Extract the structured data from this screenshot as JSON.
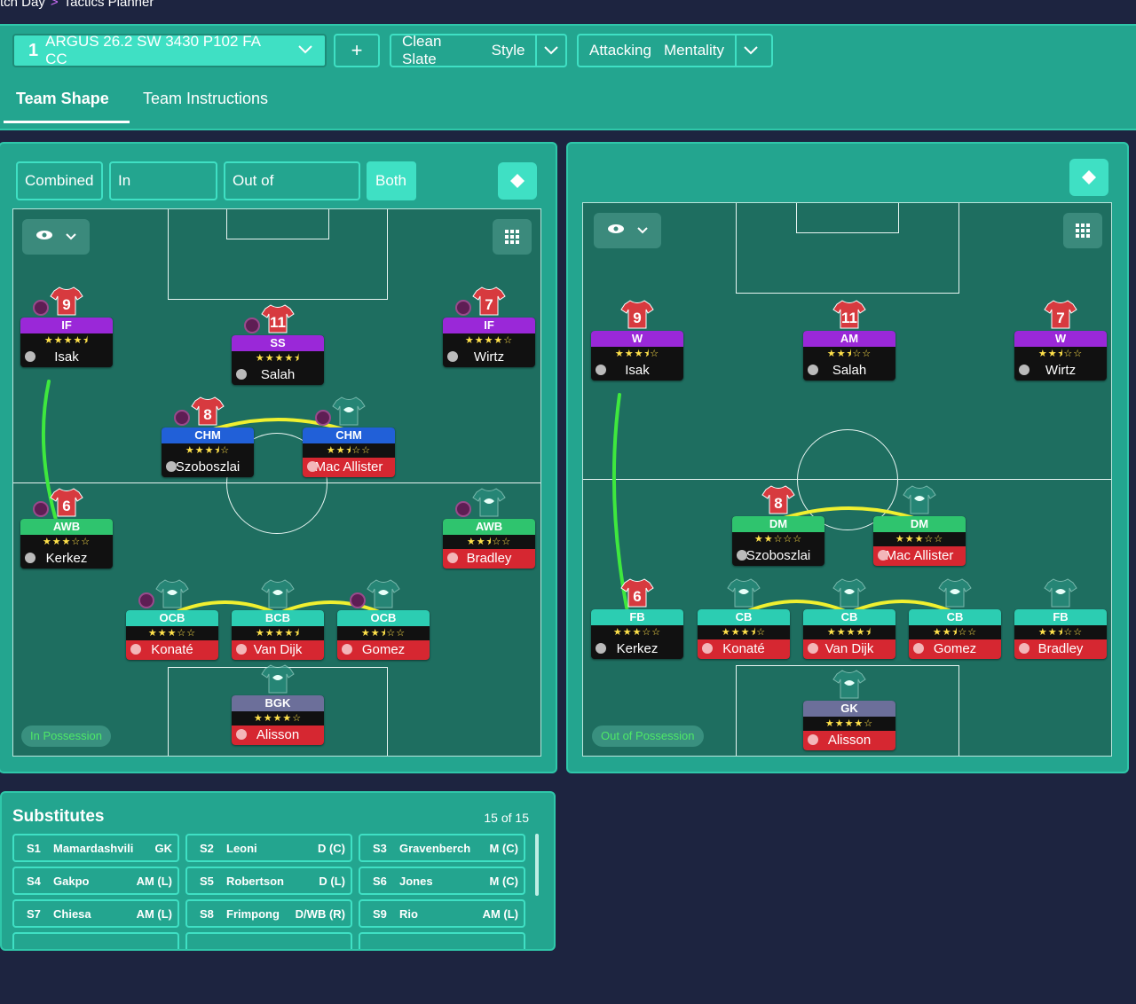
{
  "breadcrumb": {
    "parent": "tch Day",
    "current": "Tactics Planner"
  },
  "toolbar": {
    "tactic_number": "1",
    "tactic_name": "ARGUS 26.2 SW 3430 P102 FA CC",
    "add_label": "+",
    "style_value": "Clean Slate",
    "style_label": "Style",
    "mentality_value": "Attacking",
    "mentality_label": "Mentality"
  },
  "tabs": {
    "team_shape": "Team Shape",
    "team_instructions": "Team Instructions"
  },
  "view_buttons": {
    "combined": "Combined",
    "in_possession": "In Possession",
    "out_of_possession": "Out of Possession",
    "both": "Both"
  },
  "left_pitch": {
    "chip": "In Possession",
    "players": [
      {
        "id": "isak",
        "num": "9",
        "role": "IF",
        "stars": "★★★★⯨",
        "name": "Isak",
        "roleColor": "purple",
        "nameStyle": "dark"
      },
      {
        "id": "salah",
        "num": "11",
        "role": "SS",
        "stars": "★★★★⯨",
        "name": "Salah",
        "roleColor": "purple",
        "nameStyle": "dark"
      },
      {
        "id": "wirtz",
        "num": "7",
        "role": "IF",
        "stars": "★★★★☆",
        "name": "Wirtz",
        "roleColor": "purple",
        "nameStyle": "dark"
      },
      {
        "id": "szoboszlai",
        "num": "8",
        "role": "CHM",
        "stars": "★★★⯨☆",
        "name": "Szoboszlai",
        "roleColor": "blue",
        "nameStyle": "dark"
      },
      {
        "id": "macallister",
        "num": "",
        "role": "CHM",
        "stars": "★★⯨☆☆",
        "name": "Mac Allister",
        "roleColor": "blue",
        "nameStyle": "red"
      },
      {
        "id": "kerkez",
        "num": "6",
        "role": "AWB",
        "stars": "★★★☆☆",
        "name": "Kerkez",
        "roleColor": "green",
        "nameStyle": "dark"
      },
      {
        "id": "bradley",
        "num": "",
        "role": "AWB",
        "stars": "★★⯨☆☆",
        "name": "Bradley",
        "roleColor": "green",
        "nameStyle": "red"
      },
      {
        "id": "konate",
        "num": "",
        "role": "OCB",
        "stars": "★★★☆☆",
        "name": "Konaté",
        "roleColor": "teal",
        "nameStyle": "red"
      },
      {
        "id": "vandijk",
        "num": "",
        "role": "BCB",
        "stars": "★★★★⯨",
        "name": "Van Dijk",
        "roleColor": "teal",
        "nameStyle": "red"
      },
      {
        "id": "gomez",
        "num": "",
        "role": "OCB",
        "stars": "★★⯨☆☆",
        "name": "Gomez",
        "roleColor": "teal",
        "nameStyle": "red"
      },
      {
        "id": "alisson",
        "num": "",
        "role": "BGK",
        "stars": "★★★★☆",
        "name": "Alisson",
        "roleColor": "grey",
        "nameStyle": "red"
      }
    ]
  },
  "right_pitch": {
    "chip": "Out of Possession",
    "players": [
      {
        "id": "isak",
        "num": "9",
        "role": "W",
        "stars": "★★★⯨☆",
        "name": "Isak",
        "roleColor": "purple",
        "nameStyle": "dark"
      },
      {
        "id": "salah",
        "num": "11",
        "role": "AM",
        "stars": "★★⯨☆☆",
        "name": "Salah",
        "roleColor": "purple",
        "nameStyle": "dark"
      },
      {
        "id": "wirtz",
        "num": "7",
        "role": "W",
        "stars": "★★⯨☆☆",
        "name": "Wirtz",
        "roleColor": "purple",
        "nameStyle": "dark"
      },
      {
        "id": "szoboszlai",
        "num": "8",
        "role": "DM",
        "stars": "★★☆☆☆",
        "name": "Szoboszlai",
        "roleColor": "green",
        "nameStyle": "dark"
      },
      {
        "id": "macallister",
        "num": "",
        "role": "DM",
        "stars": "★★★☆☆",
        "name": "Mac Allister",
        "roleColor": "green",
        "nameStyle": "red"
      },
      {
        "id": "kerkez",
        "num": "6",
        "role": "FB",
        "stars": "★★★☆☆",
        "name": "Kerkez",
        "roleColor": "teal",
        "nameStyle": "dark"
      },
      {
        "id": "konate",
        "num": "",
        "role": "CB",
        "stars": "★★★⯨☆",
        "name": "Konaté",
        "roleColor": "teal",
        "nameStyle": "red"
      },
      {
        "id": "vandijk",
        "num": "",
        "role": "CB",
        "stars": "★★★★⯨",
        "name": "Van Dijk",
        "roleColor": "teal",
        "nameStyle": "red"
      },
      {
        "id": "gomez",
        "num": "",
        "role": "CB",
        "stars": "★★⯨☆☆",
        "name": "Gomez",
        "roleColor": "teal",
        "nameStyle": "red"
      },
      {
        "id": "bradley",
        "num": "",
        "role": "FB",
        "stars": "★★⯨☆☆",
        "name": "Bradley",
        "roleColor": "teal",
        "nameStyle": "red"
      },
      {
        "id": "alisson",
        "num": "",
        "role": "GK",
        "stars": "★★★★☆",
        "name": "Alisson",
        "roleColor": "grey",
        "nameStyle": "red"
      }
    ]
  },
  "substitutes": {
    "title": "Substitutes",
    "count": "15 of 15",
    "items": [
      {
        "slot": "S1",
        "name": "Mamardashvili",
        "pos": "GK"
      },
      {
        "slot": "S2",
        "name": "Leoni",
        "pos": "D (C)"
      },
      {
        "slot": "S3",
        "name": "Gravenberch",
        "pos": "M (C)"
      },
      {
        "slot": "S4",
        "name": "Gakpo",
        "pos": "AM (L)"
      },
      {
        "slot": "S5",
        "name": "Robertson",
        "pos": "D (L)"
      },
      {
        "slot": "S6",
        "name": "Jones",
        "pos": "M (C)"
      },
      {
        "slot": "S7",
        "name": "Chiesa",
        "pos": "AM (L)"
      },
      {
        "slot": "S8",
        "name": "Frimpong",
        "pos": "D/WB (R)"
      },
      {
        "slot": "S9",
        "name": "Rio",
        "pos": "AM (L)"
      }
    ]
  },
  "colors": {
    "panel": "#23a58f",
    "accent": "#3fe0c4",
    "pitch": "#1e6e60",
    "link_line": "#f0f030",
    "link_line_green": "#3ee83e"
  }
}
